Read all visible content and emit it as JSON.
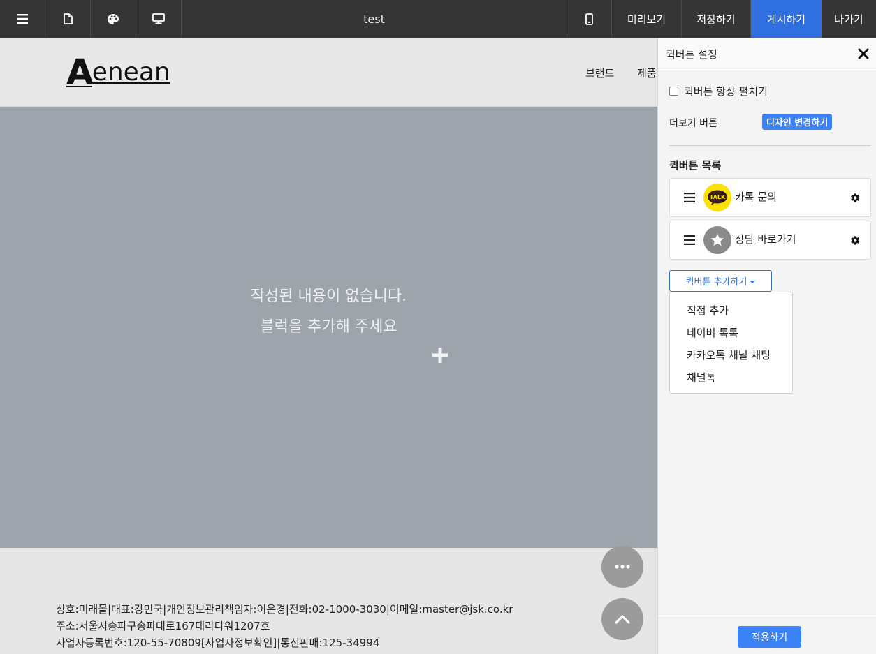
{
  "toolbar": {
    "title": "test",
    "preview": "미리보기",
    "save": "저장하기",
    "publish": "게시하기",
    "exit": "나가기",
    "icons": [
      "menu-icon",
      "page-icon",
      "palette-icon",
      "desktop-icon",
      "mobile-icon"
    ],
    "accent_color": "#2f6fe0"
  },
  "site": {
    "logo_initial": "A",
    "logo_rest": "enean",
    "nav": [
      "브랜드",
      "제품"
    ],
    "empty_line1": "작성된 내용이 없습니다.",
    "empty_line2": "블럭을 추가해 주세요",
    "footer": [
      "상호:미래몰|대표:강민국|개인정보관리책임자:이은경|전화:02-1000-3030|이메일:master@jsk.co.kr",
      "주소:서울시송파구송파대로167태라타워1207호",
      "사업자등록번호:120-55-70809[사업자정보확인]|통신판매:125-34994"
    ]
  },
  "panel": {
    "title": "퀵버튼 설정",
    "always_expand_label": "퀵버튼 항상 펼치기",
    "always_expand_checked": false,
    "more_button_label": "더보기 버튼",
    "change_design": "디자인 변경하기",
    "list_title": "퀵버튼 목록",
    "items": [
      {
        "label": "카톡 문의",
        "icon": "talk-icon",
        "icon_text": "TALK",
        "icon_color": "#fae100"
      },
      {
        "label": "상담 바로가기",
        "icon": "star-icon",
        "icon_color": "#8a8a8a"
      }
    ],
    "add_button": "퀵버튼 추가하기",
    "dropdown": [
      "직접 추가",
      "네이버 톡톡",
      "카카오톡 채널 채팅",
      "채널톡"
    ],
    "apply": "적용하기"
  }
}
